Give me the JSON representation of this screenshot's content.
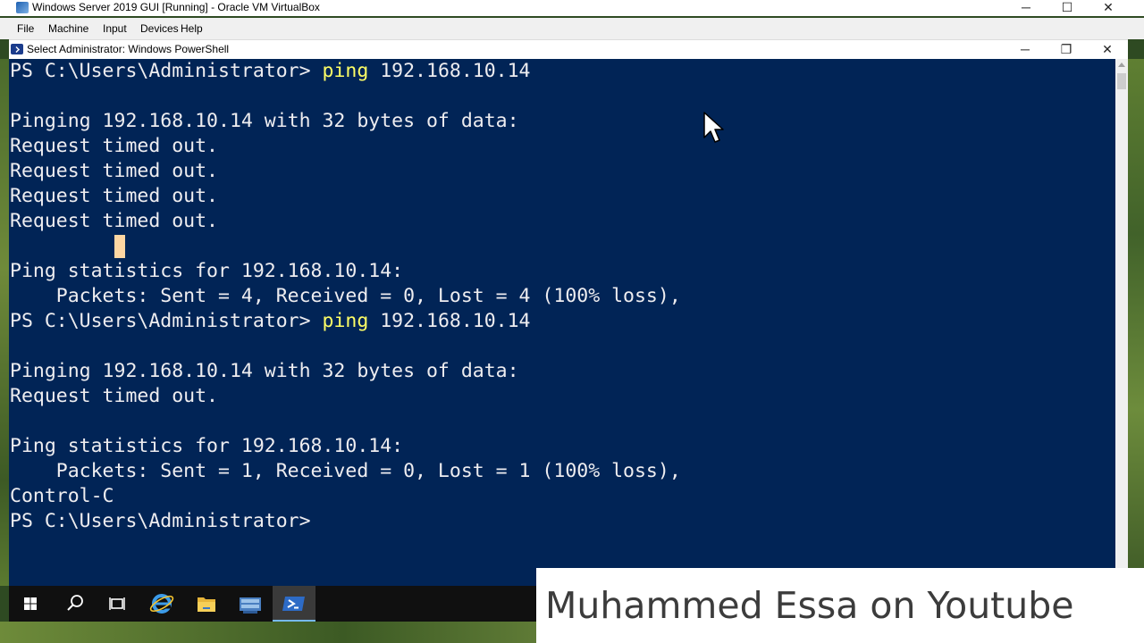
{
  "vbox": {
    "title": "Windows Server 2019 GUI [Running] - Oracle VM VirtualBox",
    "menu": [
      "File",
      "Machine",
      "Input",
      "Devices",
      "Help"
    ],
    "controls": {
      "minimize": "─",
      "maximize": "☐",
      "close": "✕"
    }
  },
  "powershell": {
    "title": "Select Administrator: Windows PowerShell",
    "controls": {
      "minimize": "─",
      "restore": "❐",
      "close": "✕"
    }
  },
  "console": {
    "lines": [
      {
        "prompt": "PS C:\\Users\\Administrator> ",
        "cmd": "ping",
        "args": " 192.168.10.14"
      },
      {
        "text": ""
      },
      {
        "text": "Pinging 192.168.10.14 with 32 bytes of data:"
      },
      {
        "text": "Request timed out."
      },
      {
        "text": "Request timed out."
      },
      {
        "text": "Request timed out."
      },
      {
        "text": "Request timed out."
      },
      {
        "text": ""
      },
      {
        "text": "Ping statistics for 192.168.10.14:"
      },
      {
        "text": "    Packets: Sent = 4, Received = 0, Lost = 4 (100% loss),"
      },
      {
        "prompt": "PS C:\\Users\\Administrator> ",
        "cmd": "ping",
        "args": " 192.168.10.14"
      },
      {
        "text": ""
      },
      {
        "text": "Pinging 192.168.10.14 with 32 bytes of data:"
      },
      {
        "text": "Request timed out."
      },
      {
        "text": ""
      },
      {
        "text": "Ping statistics for 192.168.10.14:"
      },
      {
        "text": "    Packets: Sent = 1, Received = 0, Lost = 1 (100% loss),"
      },
      {
        "text": "Control-C"
      },
      {
        "prompt": "PS C:\\Users\\Administrator> ",
        "cmd": "",
        "args": ""
      }
    ]
  },
  "taskbar": {
    "items": [
      "start-icon",
      "search-icon",
      "task-view-icon",
      "internet-explorer-icon",
      "file-explorer-icon",
      "server-manager-icon",
      "powershell-icon"
    ]
  },
  "watermark": "Muhammed Essa on Youtube",
  "colors": {
    "console_bg": "#012456",
    "console_fg": "#eeedf0",
    "command": "#ffff66"
  }
}
